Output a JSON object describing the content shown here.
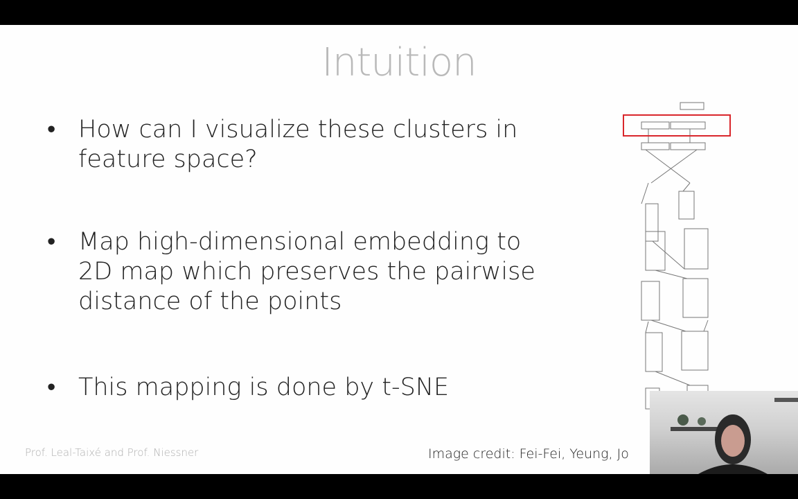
{
  "slide": {
    "title": "Intuition",
    "bullets": [
      {
        "marker": "•",
        "text": "How can I visualize these clusters in\nfeature space?"
      },
      {
        "marker": "•",
        "text": "Map high-dimensional embedding to\n2D map which preserves the pairwise\ndistance of the points"
      },
      {
        "marker": "•",
        "text": "This mapping is done by t-SNE"
      }
    ],
    "footer": "Prof. Leal-Taixé and Prof. Niessner",
    "credit": "Image credit: Fei-Fei, Yeung, Jo"
  },
  "colors": {
    "highlight_box": "#d9262b",
    "title": "#b9b9b9",
    "body_text": "#222222"
  },
  "icons": {
    "diagram": "cnn-architecture-diagram",
    "webcam": "presenter-webcam-overlay"
  }
}
